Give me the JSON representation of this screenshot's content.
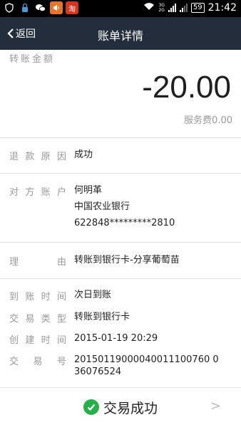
{
  "status_bar": {
    "app_badge": "淘",
    "network_top": "3G",
    "network_bottom": "2G",
    "battery": "59",
    "time": "21:42"
  },
  "header": {
    "back_label": "返回",
    "title": "账单详情"
  },
  "amount": {
    "label": "转账金额",
    "value": "-20.00",
    "fee": "服务费0.00"
  },
  "details": {
    "refund_reason_label": [
      "退",
      "款",
      "原",
      "因"
    ],
    "refund_reason_value": "成功",
    "counterparty_label": [
      "对",
      "方",
      "账",
      "户"
    ],
    "counterparty_name": "何明革",
    "counterparty_bank": "中国农业银行",
    "counterparty_card": "622848*********2810",
    "reason_label": [
      "理",
      "由"
    ],
    "reason_value": "转账到银行卡-分享葡萄苗",
    "arrival_label": [
      "到",
      "账",
      "时",
      "间"
    ],
    "arrival_value": "次日到账",
    "type_label": [
      "交",
      "易",
      "类",
      "型"
    ],
    "type_value": "转账到银行卡",
    "created_label": [
      "创",
      "建",
      "时",
      "间"
    ],
    "created_value": "2015-01-19 20:29",
    "txid_label": [
      "交",
      "易",
      "号"
    ],
    "txid_line1": "20150119000040011100760 0",
    "txid_line2": "36076524"
  },
  "footer": {
    "status_text": "交易成功",
    "chevron": ">"
  },
  "colors": {
    "header_bg": "#232d3c",
    "success_green": "#27b04a"
  }
}
